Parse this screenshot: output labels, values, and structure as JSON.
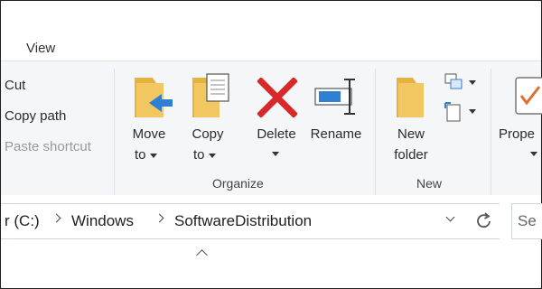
{
  "tabs": {
    "view": "View"
  },
  "clipboard": {
    "cut": "Cut",
    "copy_path": "Copy path",
    "paste_shortcut": "Paste shortcut"
  },
  "organize": {
    "move_to": [
      "Move",
      "to"
    ],
    "copy_to": [
      "Copy",
      "to"
    ],
    "delete": "Delete",
    "rename": "Rename",
    "group_label": "Organize"
  },
  "new": {
    "new_folder": [
      "New",
      "folder"
    ],
    "group_label": "New"
  },
  "open": {
    "properties": "Prope"
  },
  "address": {
    "drive": "r (C:)",
    "crumbs": [
      "Windows",
      "SoftwareDistribution"
    ]
  },
  "search": {
    "placeholder": "Se"
  },
  "colors": {
    "folder": "#f2c761",
    "delete_red": "#d9282a",
    "rename_blue": "#2f7fd3",
    "ribbon_bg": "#f4f6f8"
  },
  "icons": [
    "folder-move-icon",
    "folder-copy-icon",
    "delete-x-icon",
    "rename-icon",
    "new-folder-icon",
    "new-item-icon",
    "easy-access-icon",
    "properties-icon",
    "dropdown-caret-icon",
    "refresh-icon",
    "collapse-ribbon-icon"
  ]
}
